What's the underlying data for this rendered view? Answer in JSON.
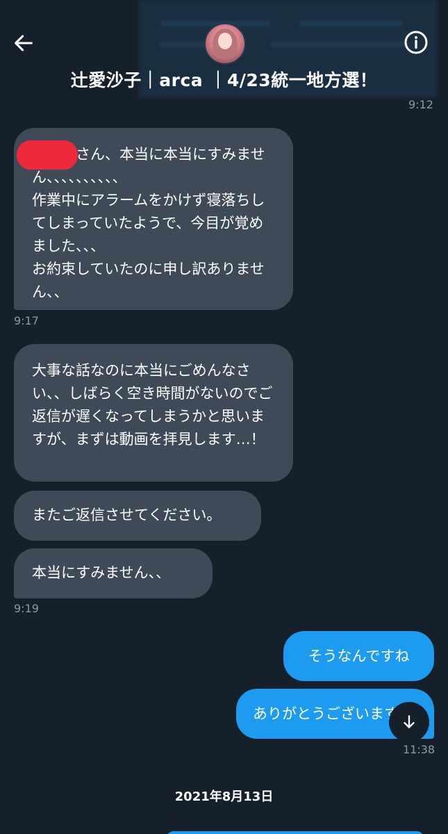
{
  "header": {
    "title": "辻愛沙子｜arca ｜4/23統一地方選！",
    "back_icon": "arrow-left-icon",
    "info_icon": "info-circle-icon",
    "avatar": "profile-avatar"
  },
  "messages": {
    "time_0912": "9:12",
    "in_1": "　　　さん、本当に本当にすみません、、、、、、、、、、\n作業中にアラームをかけず寝落ちしてしまっていたようで、今目が覚めました、、、\nお約束していたのに申し訳ありません、、",
    "time_0917": "9:17",
    "in_2": "大事な話なのに本当にごめんなさい、、しばらく空き時間がないのでご返信が遅くなってしまうかと思いますが、まずは動画を拝見します…！",
    "in_3": "またご返信させてください。",
    "in_4": "本当にすみません、、",
    "time_0919": "9:19",
    "out_1": "そうなんですね",
    "out_2": "ありがとうございます",
    "time_1138": "11:38"
  },
  "date_divider": "2021年8月13日",
  "colors": {
    "background": "#15202b",
    "incoming_bubble": "#3e4a57",
    "outgoing_bubble": "#1d9bf0",
    "timestamp": "#8899a6",
    "redaction": "#f0283c"
  },
  "scroll_icon": "arrow-down-icon"
}
